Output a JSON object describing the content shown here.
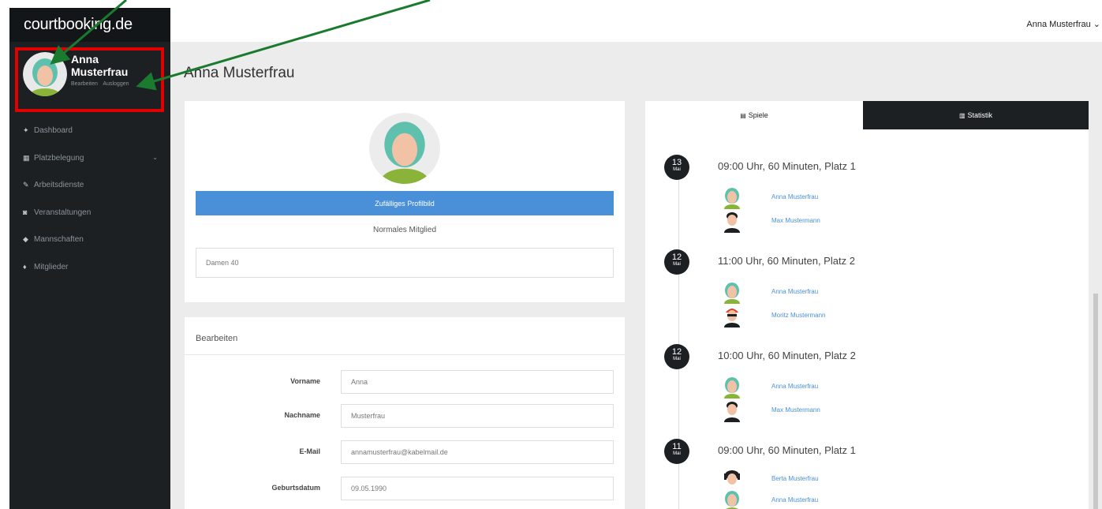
{
  "app": {
    "logo": "courtbooking.de"
  },
  "header": {
    "user_menu": "Anna Musterfrau ⌄"
  },
  "sidebar": {
    "profile_name": "Anna Musterfrau",
    "profile_links": [
      "Bearbeiten",
      "Ausloggen"
    ],
    "items": [
      {
        "label": "Dashboard",
        "icon": "home-icon",
        "glyph": "✦"
      },
      {
        "label": "Platzbelegung",
        "icon": "calendar-icon",
        "glyph": "▦",
        "caret": "⌄"
      },
      {
        "label": "Arbeitsdienste",
        "icon": "wrench-icon",
        "glyph": "✎"
      },
      {
        "label": "Veranstaltungen",
        "icon": "map-icon",
        "glyph": "◙"
      },
      {
        "label": "Mannschaften",
        "icon": "users-icon",
        "glyph": "◆"
      },
      {
        "label": "Mitglieder",
        "icon": "person-icon",
        "glyph": "♦"
      }
    ]
  },
  "page": {
    "title": "Anna Musterfrau"
  },
  "profile_card": {
    "random_button": "Zufälliges Profilbild",
    "member_type": "Normales Mitglied",
    "team": "Damen 40"
  },
  "edit_card": {
    "header": "Bearbeiten",
    "fields": [
      {
        "label": "Vorname",
        "value": "Anna"
      },
      {
        "label": "Nachname",
        "value": "Musterfrau"
      },
      {
        "label": "E-Mail",
        "value": "annamusterfrau@kabelmail.de"
      },
      {
        "label": "Geburtsdatum",
        "value": "09.05.1990"
      }
    ]
  },
  "games": {
    "tabs": [
      {
        "label": "Spiele",
        "icon": "list-icon",
        "glyph": "▤"
      },
      {
        "label": "Statistik",
        "icon": "chart-icon",
        "glyph": "▥"
      }
    ],
    "entries": [
      {
        "day": "13",
        "month": "Mai",
        "title": "09:00 Uhr, 60 Minuten, Platz 1",
        "players": [
          {
            "name": "Anna Musterfrau",
            "avatar": "woman-teal"
          },
          {
            "name": "Max Mustermann",
            "avatar": "man-dark"
          }
        ]
      },
      {
        "day": "12",
        "month": "Mai",
        "title": "11:00 Uhr, 60 Minuten, Platz 2",
        "players": [
          {
            "name": "Anna Musterfrau",
            "avatar": "woman-teal"
          },
          {
            "name": "Moritz Mustermann",
            "avatar": "man-redcap"
          }
        ]
      },
      {
        "day": "12",
        "month": "Mai",
        "title": "10:00 Uhr, 60 Minuten, Platz 2",
        "players": [
          {
            "name": "Anna Musterfrau",
            "avatar": "woman-teal"
          },
          {
            "name": "Max Mustermann",
            "avatar": "man-dark"
          }
        ]
      },
      {
        "day": "11",
        "month": "Mai",
        "title": "09:00 Uhr, 60 Minuten, Platz 1",
        "players": [
          {
            "name": "Berta Musterfrau",
            "avatar": "woman-dark"
          },
          {
            "name": "Anna Musterfrau",
            "avatar": "woman-teal"
          }
        ]
      }
    ]
  },
  "colors": {
    "sidebar": "#1c2023",
    "accent": "#4a90d9",
    "highlight": "#e00000",
    "arrow": "#1a7a2e"
  }
}
